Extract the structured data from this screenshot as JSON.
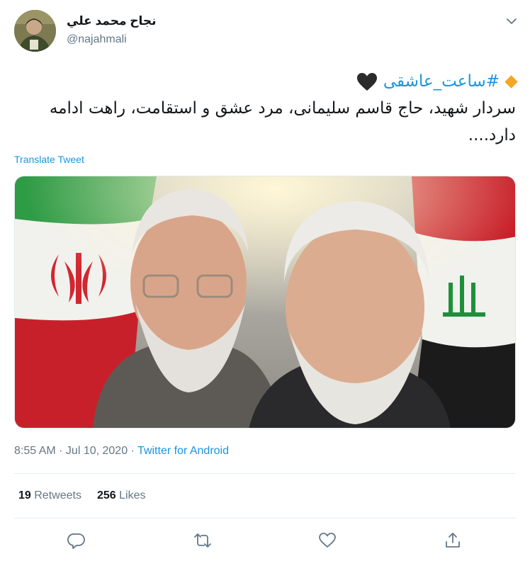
{
  "user": {
    "display_name": "نجاح محمد علي",
    "handle": "@najahmali",
    "avatar_icon": "user-avatar"
  },
  "tweet": {
    "hashtag": "#ساعت_عاشقی",
    "text": "سردار شهید، حاج قاسم سلیمانی، مرد عشق و استقامت، راهت ادامه دارد....",
    "emoji_lead": "orange-diamond",
    "emoji_trail": "black-heart"
  },
  "translate_label": "Translate Tweet",
  "meta": {
    "time": "8:55 AM",
    "sep1": " · ",
    "date": "Jul 10, 2020",
    "sep2": " · ",
    "source": "Twitter for Android"
  },
  "stats": {
    "retweets_count": "19",
    "retweets_label": "Retweets",
    "likes_count": "256",
    "likes_label": "Likes"
  },
  "actions": [
    "reply-icon",
    "retweet-icon",
    "like-icon",
    "share-icon"
  ],
  "colors": {
    "link": "#1b95e0",
    "muted": "#657786",
    "text": "#14171a",
    "divider": "#e6ecf0"
  }
}
